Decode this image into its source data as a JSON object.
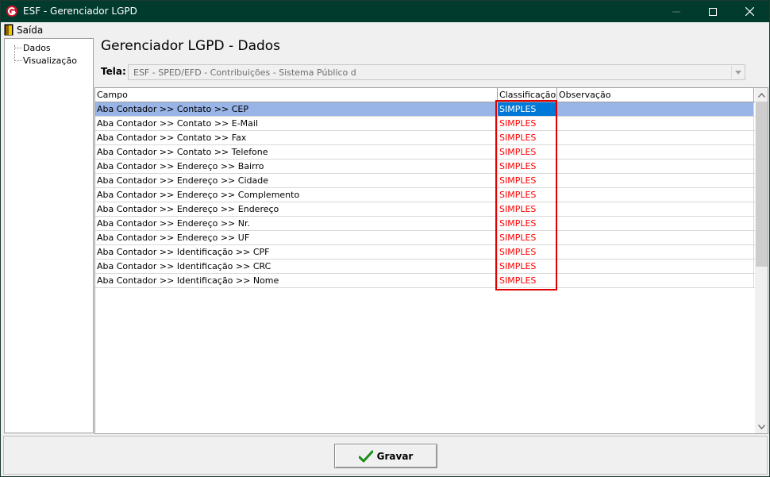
{
  "window": {
    "title": "ESF - Gerenciador LGPD"
  },
  "menu": {
    "exit_label": "Saída"
  },
  "tree": {
    "items": [
      "Dados",
      "Visualização"
    ]
  },
  "main": {
    "title": "Gerenciador LGPD - Dados",
    "tela_label": "Tela:",
    "tela_value": "ESF - SPED/EFD - Contribuições - Sistema Público d"
  },
  "grid": {
    "columns": [
      "Campo",
      "Classificação",
      "Observação"
    ],
    "rows": [
      {
        "campo": "Aba Contador >> Contato >> CEP",
        "classificacao": "SIMPLES",
        "observacao": ""
      },
      {
        "campo": "Aba Contador >> Contato >> E-Mail",
        "classificacao": "SIMPLES",
        "observacao": ""
      },
      {
        "campo": "Aba Contador >> Contato >> Fax",
        "classificacao": "SIMPLES",
        "observacao": ""
      },
      {
        "campo": "Aba Contador >> Contato >> Telefone",
        "classificacao": "SIMPLES",
        "observacao": ""
      },
      {
        "campo": "Aba Contador >> Endereço >> Bairro",
        "classificacao": "SIMPLES",
        "observacao": ""
      },
      {
        "campo": "Aba Contador >> Endereço >> Cidade",
        "classificacao": "SIMPLES",
        "observacao": ""
      },
      {
        "campo": "Aba Contador >> Endereço >> Complemento",
        "classificacao": "SIMPLES",
        "observacao": ""
      },
      {
        "campo": "Aba Contador >> Endereço >> Endereço",
        "classificacao": "SIMPLES",
        "observacao": ""
      },
      {
        "campo": "Aba Contador >> Endereço >> Nr.",
        "classificacao": "SIMPLES",
        "observacao": ""
      },
      {
        "campo": "Aba Contador >> Endereço >> UF",
        "classificacao": "SIMPLES",
        "observacao": ""
      },
      {
        "campo": "Aba Contador >> Identificação >> CPF",
        "classificacao": "SIMPLES",
        "observacao": ""
      },
      {
        "campo": "Aba Contador >> Identificação >> CRC",
        "classificacao": "SIMPLES",
        "observacao": ""
      },
      {
        "campo": "Aba Contador >> Identificação >> Nome",
        "classificacao": "SIMPLES",
        "observacao": ""
      }
    ]
  },
  "buttons": {
    "gravar_label": "Gravar"
  },
  "colors": {
    "titlebar": "#003b2e",
    "selection": "#0078d7",
    "classification_text": "#ff0000",
    "highlight": "#e00000"
  }
}
